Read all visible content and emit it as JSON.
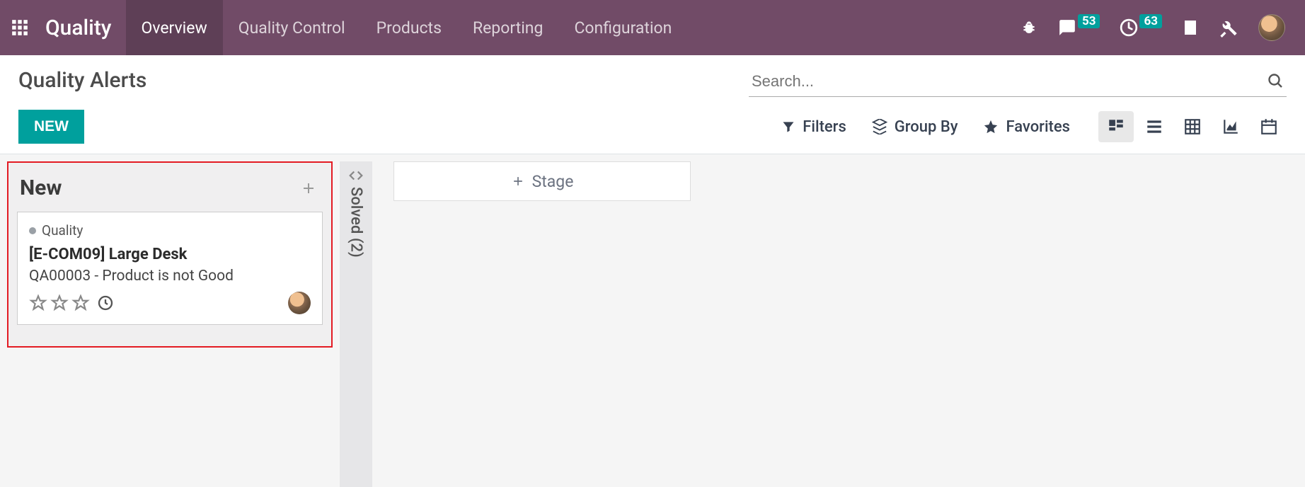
{
  "nav": {
    "app_title": "Quality",
    "menu": [
      "Overview",
      "Quality Control",
      "Products",
      "Reporting",
      "Configuration"
    ],
    "active_index": 0,
    "badges": {
      "discuss": "53",
      "activities": "63"
    }
  },
  "control_panel": {
    "breadcrumb": "Quality Alerts",
    "new_label": "NEW",
    "search_placeholder": "Search...",
    "filters_label": "Filters",
    "groupby_label": "Group By",
    "favorites_label": "Favorites"
  },
  "kanban": {
    "columns": [
      {
        "title": "New",
        "cards": [
          {
            "tag": "Quality",
            "title": "[E-COM09] Large Desk",
            "subtitle": "QA00003 - Product is not Good",
            "stars": 0
          }
        ]
      }
    ],
    "folded": {
      "title": "Solved",
      "count": 2,
      "label": "Solved (2)"
    },
    "add_stage_label": "Stage"
  }
}
